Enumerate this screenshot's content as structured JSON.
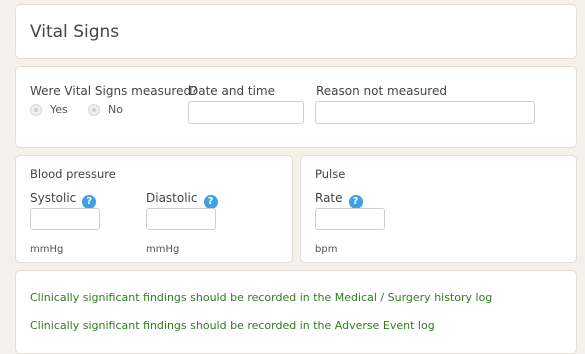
{
  "header": {
    "title": "Vital Signs"
  },
  "measurement": {
    "question_label": "Were Vital Signs measured?",
    "options": [
      {
        "label": "Yes"
      },
      {
        "label": "No"
      }
    ],
    "date_label": "Date and time",
    "date_value": "",
    "reason_label": "Reason not measured",
    "reason_value": ""
  },
  "blood_pressure": {
    "section_label": "Blood pressure",
    "systolic_label": "Systolic",
    "systolic_value": "",
    "systolic_unit": "mmHg",
    "diastolic_label": "Diastolic",
    "diastolic_value": "",
    "diastolic_unit": "mmHg",
    "help_glyph": "?"
  },
  "pulse": {
    "section_label": "Pulse",
    "rate_label": "Rate",
    "rate_value": "",
    "rate_unit": "bpm",
    "help_glyph": "?"
  },
  "findings": {
    "notes": [
      "Clinically significant findings should be recorded in the Medical / Surgery history log",
      "Clinically significant findings should be recorded in the Adverse Event log"
    ]
  },
  "colors": {
    "background": "#f4f0ea",
    "help_icon": "#3da0e4",
    "note_text": "#2f7d1f"
  }
}
